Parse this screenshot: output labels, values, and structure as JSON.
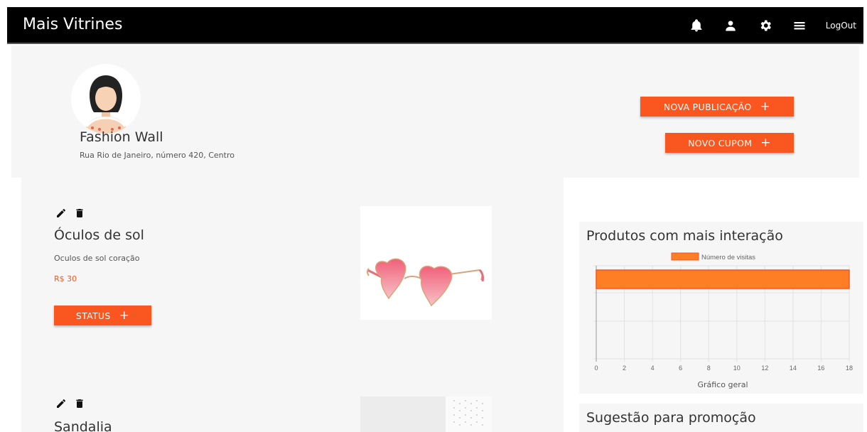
{
  "header": {
    "brand": "Mais Vitrines",
    "icons": [
      "bell-icon",
      "user-icon",
      "gear-icon",
      "menu-icon"
    ],
    "logout_label": "LogOut"
  },
  "profile": {
    "name": "Fashion Wall",
    "address": "Rua Rio de Janeiro, número 420, Centro",
    "new_post_label": "NOVA PUBLICAÇÃO",
    "new_coupon_label": "NOVO CUPOM"
  },
  "products": [
    {
      "name": "Óculos de sol",
      "description": "Oculos de sol coração",
      "price": "R$ 30",
      "status_label": "STATUS"
    },
    {
      "name": "Sandalia"
    }
  ],
  "chart_section": {
    "title": "Produtos com mais interação"
  },
  "chart_data": {
    "type": "bar",
    "orientation": "horizontal",
    "categories": [
      ""
    ],
    "series": [
      {
        "name": "Número de visitas",
        "values": [
          18
        ]
      }
    ],
    "xlabel": "Gráfico geral",
    "xlim": [
      0,
      18
    ],
    "xticks": [
      0,
      2,
      4,
      6,
      8,
      10,
      12,
      14,
      16,
      18
    ],
    "grid": true,
    "legend": "top",
    "colors": {
      "bar": "#fe7e26",
      "bar_border": "#fa561f"
    }
  },
  "promo_section": {
    "title": "Sugestão para promoção"
  },
  "colors": {
    "accent": "#fa561f",
    "header_bg": "#000000",
    "panel_bg": "#f6f6f6"
  }
}
